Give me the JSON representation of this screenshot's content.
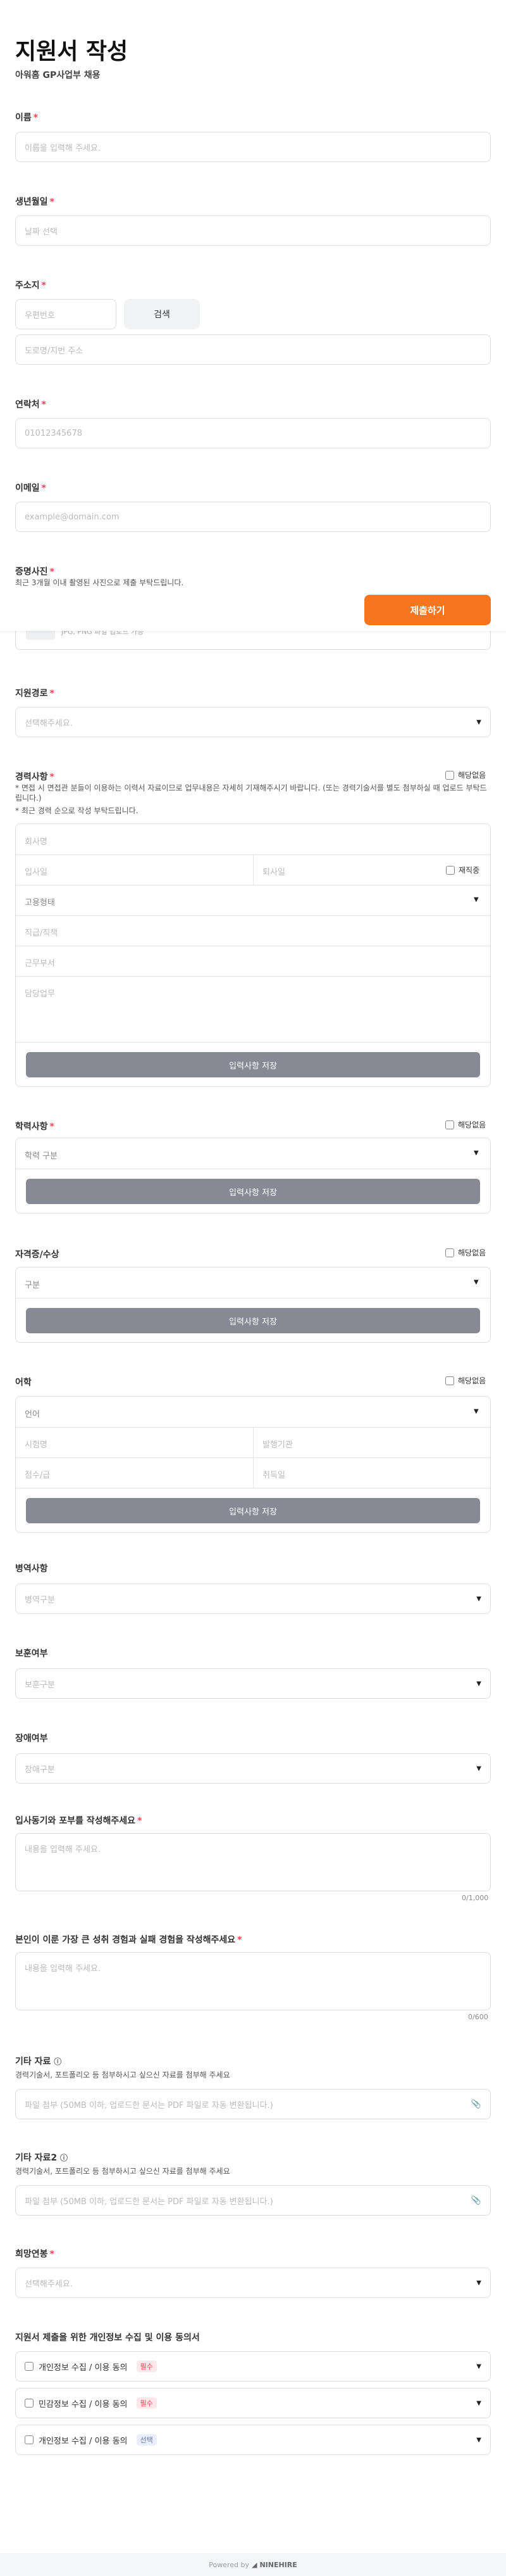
{
  "header": {
    "title": "지원서 작성",
    "subtitle": "아워홈 GP사업부 채용"
  },
  "required_mark": "*",
  "name": {
    "label": "이름",
    "placeholder": "이름을 입력해 주세요."
  },
  "birth": {
    "label": "생년월일",
    "placeholder": "날짜 선택"
  },
  "address": {
    "label": "주소지",
    "zip_placeholder": "우편번호",
    "search_label": "검색",
    "detail_placeholder": "도로명/지번 주소"
  },
  "phone": {
    "label": "연락처",
    "placeholder": "01012345678"
  },
  "email": {
    "label": "이메일",
    "placeholder": "example@domain.com"
  },
  "photo": {
    "label": "증명사진",
    "note": "최근 3개월 이내 촬영된 사진으로 제출 부탁드립니다.",
    "hint": "JPG, PNG 파일 업로드 가능"
  },
  "submit": {
    "label": "제출하기"
  },
  "route": {
    "label": "지원경로",
    "placeholder": "선택해주세요."
  },
  "career": {
    "label": "경력사항",
    "none_label": "해당없음",
    "notes": [
      "* 면접 시 면접관 분들이 이용하는 이력서 자료이므로 업무내용은 자세히 기재해주시기 바랍니다. (또는 경력기술서를 별도 첨부하실 때 업로드 부탁드립니다.)",
      "* 최근 경력 순으로 작성 부탁드립니다."
    ],
    "company": "회사명",
    "start": "입사일",
    "end": "퇴사일",
    "employed": "재직중",
    "employment_type": "고용형태",
    "position": "직급/직책",
    "department": "근무부서",
    "duties": "담당업무",
    "save": "입력사항 저장"
  },
  "education": {
    "label": "학력사항",
    "none_label": "해당없음",
    "type_placeholder": "학력 구분",
    "save": "입력사항 저장"
  },
  "license": {
    "label": "자격증/수상",
    "none_label": "해당없음",
    "type_placeholder": "구분",
    "save": "입력사항 저장"
  },
  "language": {
    "label": "어학",
    "none_label": "해당없음",
    "lang_placeholder": "언어",
    "exam": "시험명",
    "org": "발행기관",
    "score": "점수/급",
    "date": "취득일",
    "save": "입력사항 저장"
  },
  "military": {
    "label": "병역사항",
    "placeholder": "병역구분"
  },
  "veteran": {
    "label": "보훈여부",
    "placeholder": "보훈구분"
  },
  "disability": {
    "label": "장애여부",
    "placeholder": "장애구분"
  },
  "motivation": {
    "label": "입사동기와 포부를 작성해주세요",
    "placeholder": "내용을 입력해 주세요.",
    "count": "0/1,000"
  },
  "experience": {
    "label": "본인이 이룬 가장 큰 성취 경험과 실패 경험을 작성해주세요",
    "placeholder": "내용을 입력해 주세요.",
    "count": "0/600"
  },
  "etc1": {
    "label": "기타 자료",
    "note": "경력기술서, 포트폴리오 등 첨부하시고 싶으신 자료를 첨부해 주세요",
    "placeholder": "파일 첨부 (50MB 이하, 업로드한 문서는 PDF 파일로 자동 변환됩니다.)"
  },
  "etc2": {
    "label": "기타 자료2",
    "note": "경력기술서, 포트폴리오 등 첨부하시고 싶으신 자료를 첨부해 주세요",
    "placeholder": "파일 첨부 (50MB 이하, 업로드한 문서는 PDF 파일로 자동 변환됩니다.)"
  },
  "salary": {
    "label": "희망연봉",
    "placeholder": "선택해주세요."
  },
  "consent": {
    "title": "지원서 제출을 위한 개인정보 수집 및 이용 동의서",
    "items": [
      {
        "label": "개인정보 수집 / 이용 동의",
        "badge": "필수"
      },
      {
        "label": "민감정보 수집 / 이용 동의",
        "badge": "필수"
      },
      {
        "label": "개인정보 수집 / 이용 동의",
        "badge": "선택"
      }
    ]
  },
  "footer": {
    "text": "Powered by",
    "brand": "NINEHIRE"
  },
  "colors": {
    "accent": "#f7751e",
    "required": "#f04452",
    "save_button": "#878a94"
  }
}
